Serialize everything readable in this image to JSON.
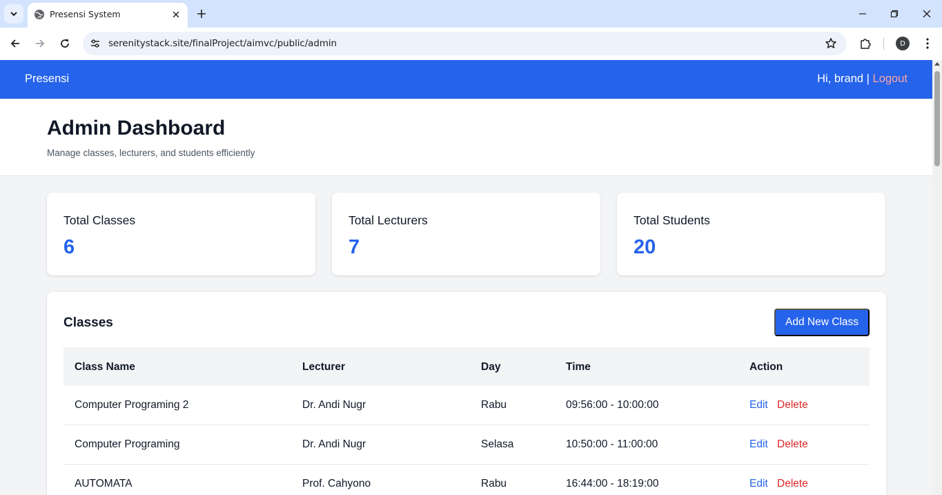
{
  "browser": {
    "tab_title": "Presensi System",
    "url": "serenitystack.site/finalProject/aimvc/public/admin",
    "profile_initial": "D"
  },
  "navbar": {
    "brand": "Presensi",
    "greeting": "Hi, brand",
    "separator": "|",
    "logout": "Logout"
  },
  "header": {
    "title": "Admin Dashboard",
    "subtitle": "Manage classes, lecturers, and students efficiently"
  },
  "stats": [
    {
      "label": "Total Classes",
      "value": "6"
    },
    {
      "label": "Total Lecturers",
      "value": "7"
    },
    {
      "label": "Total Students",
      "value": "20"
    }
  ],
  "classes": {
    "title": "Classes",
    "add_button": "Add New Class",
    "columns": [
      "Class Name",
      "Lecturer",
      "Day",
      "Time",
      "Action"
    ],
    "rows": [
      {
        "name": "Computer Programing 2",
        "lecturer": "Dr. Andi Nugr",
        "day": "Rabu",
        "time": "09:56:00 - 10:00:00",
        "edit": "Edit",
        "delete": "Delete"
      },
      {
        "name": "Computer Programing",
        "lecturer": "Dr. Andi Nugr",
        "day": "Selasa",
        "time": "10:50:00 - 11:00:00",
        "edit": "Edit",
        "delete": "Delete"
      },
      {
        "name": "AUTOMATA",
        "lecturer": "Prof. Cahyono",
        "day": "Rabu",
        "time": "16:44:00 - 18:19:00",
        "edit": "Edit",
        "delete": "Delete"
      }
    ]
  },
  "colors": {
    "primary": "#2563eb",
    "logout": "#fca5a5",
    "delete": "#dc2626",
    "page_bg": "#f3f4f6"
  }
}
